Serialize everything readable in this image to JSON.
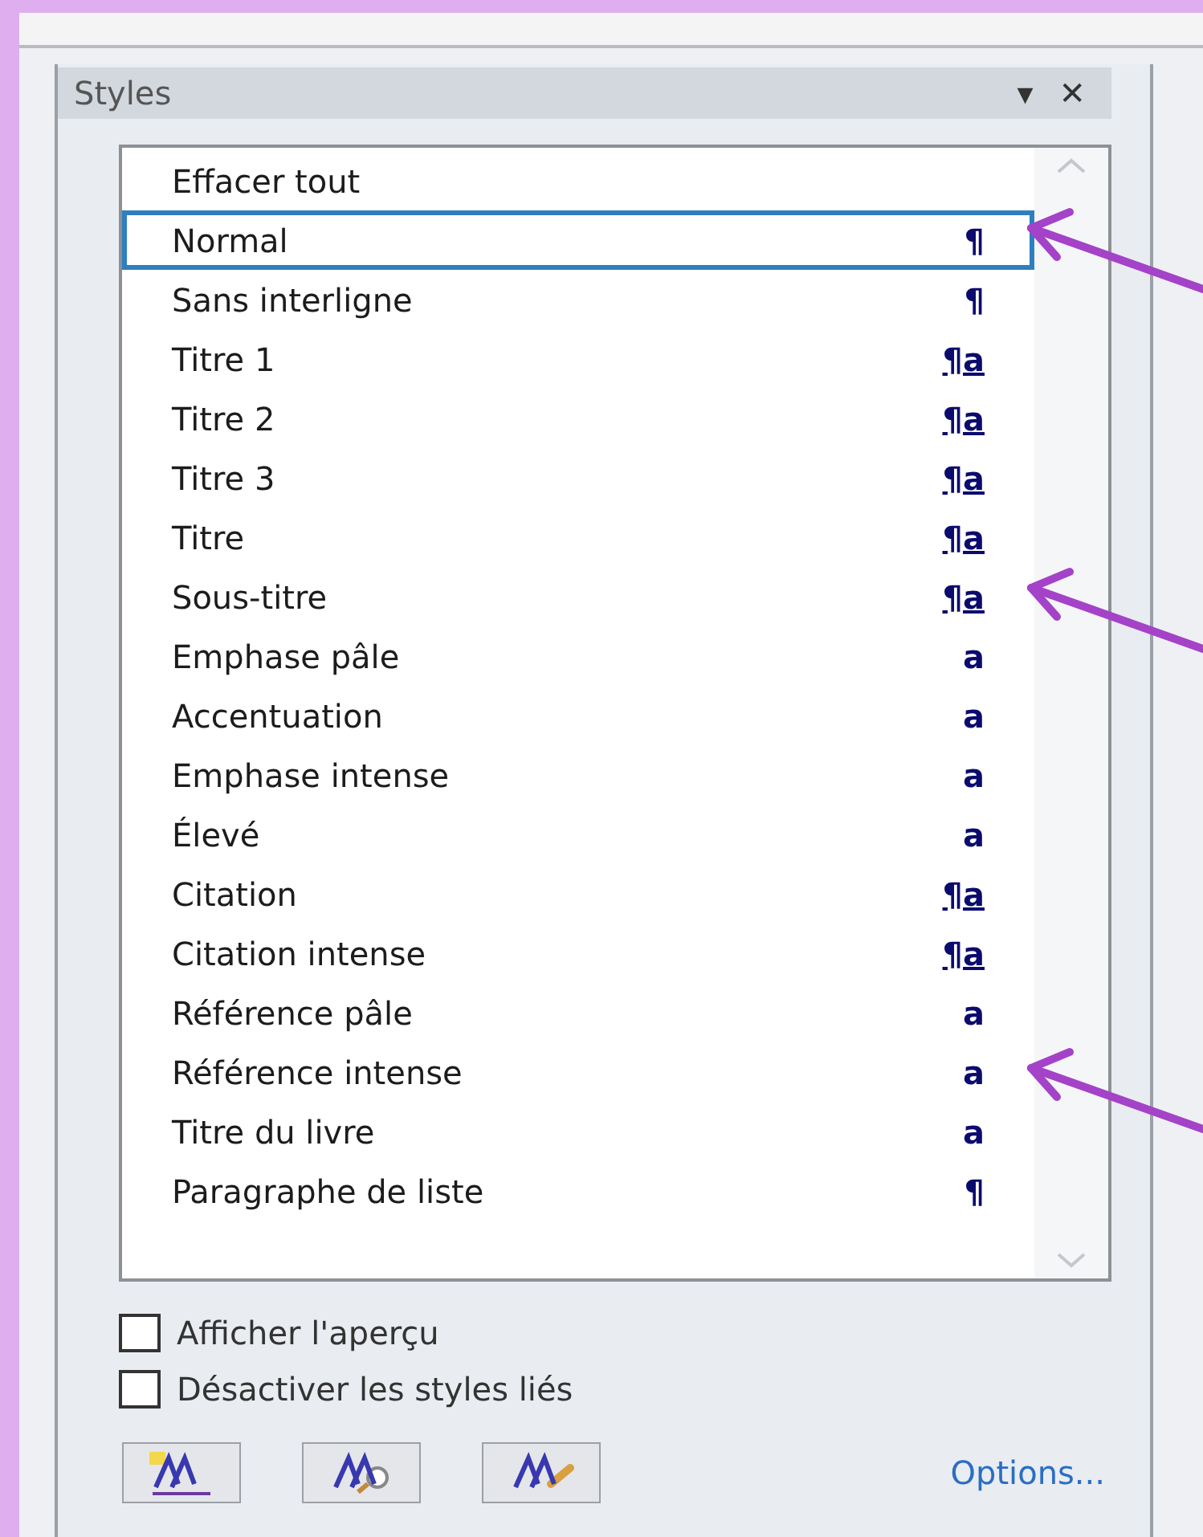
{
  "pane": {
    "title": "Styles",
    "menu_glyph": "▾",
    "close_glyph": "✕"
  },
  "styles": [
    {
      "label": "Effacer tout",
      "kind": "clear",
      "selected": false
    },
    {
      "label": "Normal",
      "marker": "¶",
      "kind": "paragraph",
      "selected": true
    },
    {
      "label": "Sans interligne",
      "marker": "¶",
      "kind": "paragraph",
      "selected": false
    },
    {
      "label": "Titre 1",
      "marker": "¶a",
      "kind": "linked",
      "selected": false
    },
    {
      "label": "Titre 2",
      "marker": "¶a",
      "kind": "linked",
      "selected": false
    },
    {
      "label": "Titre 3",
      "marker": "¶a",
      "kind": "linked",
      "selected": false
    },
    {
      "label": "Titre",
      "marker": "¶a",
      "kind": "linked",
      "selected": false
    },
    {
      "label": "Sous-titre",
      "marker": "¶a",
      "kind": "linked",
      "selected": false
    },
    {
      "label": "Emphase pâle",
      "marker": "a",
      "kind": "character",
      "selected": false
    },
    {
      "label": "Accentuation",
      "marker": "a",
      "kind": "character",
      "selected": false
    },
    {
      "label": "Emphase intense",
      "marker": "a",
      "kind": "character",
      "selected": false
    },
    {
      "label": "Élevé",
      "marker": "a",
      "kind": "character",
      "selected": false
    },
    {
      "label": "Citation",
      "marker": "¶a",
      "kind": "linked",
      "selected": false
    },
    {
      "label": "Citation intense",
      "marker": "¶a",
      "kind": "linked",
      "selected": false
    },
    {
      "label": "Référence pâle",
      "marker": "a",
      "kind": "character",
      "selected": false
    },
    {
      "label": "Référence intense",
      "marker": "a",
      "kind": "character",
      "selected": false
    },
    {
      "label": "Titre du livre",
      "marker": "a",
      "kind": "character",
      "selected": false
    },
    {
      "label": "Paragraphe de liste",
      "marker": "¶",
      "kind": "paragraph",
      "selected": false
    }
  ],
  "options": [
    {
      "label": "Afficher l'aperçu",
      "checked": false
    },
    {
      "label": "Désactiver les styles liés",
      "checked": false
    }
  ],
  "tools": [
    {
      "kind": "new"
    },
    {
      "kind": "inspect"
    },
    {
      "kind": "manage"
    }
  ],
  "options_link": "Options..."
}
